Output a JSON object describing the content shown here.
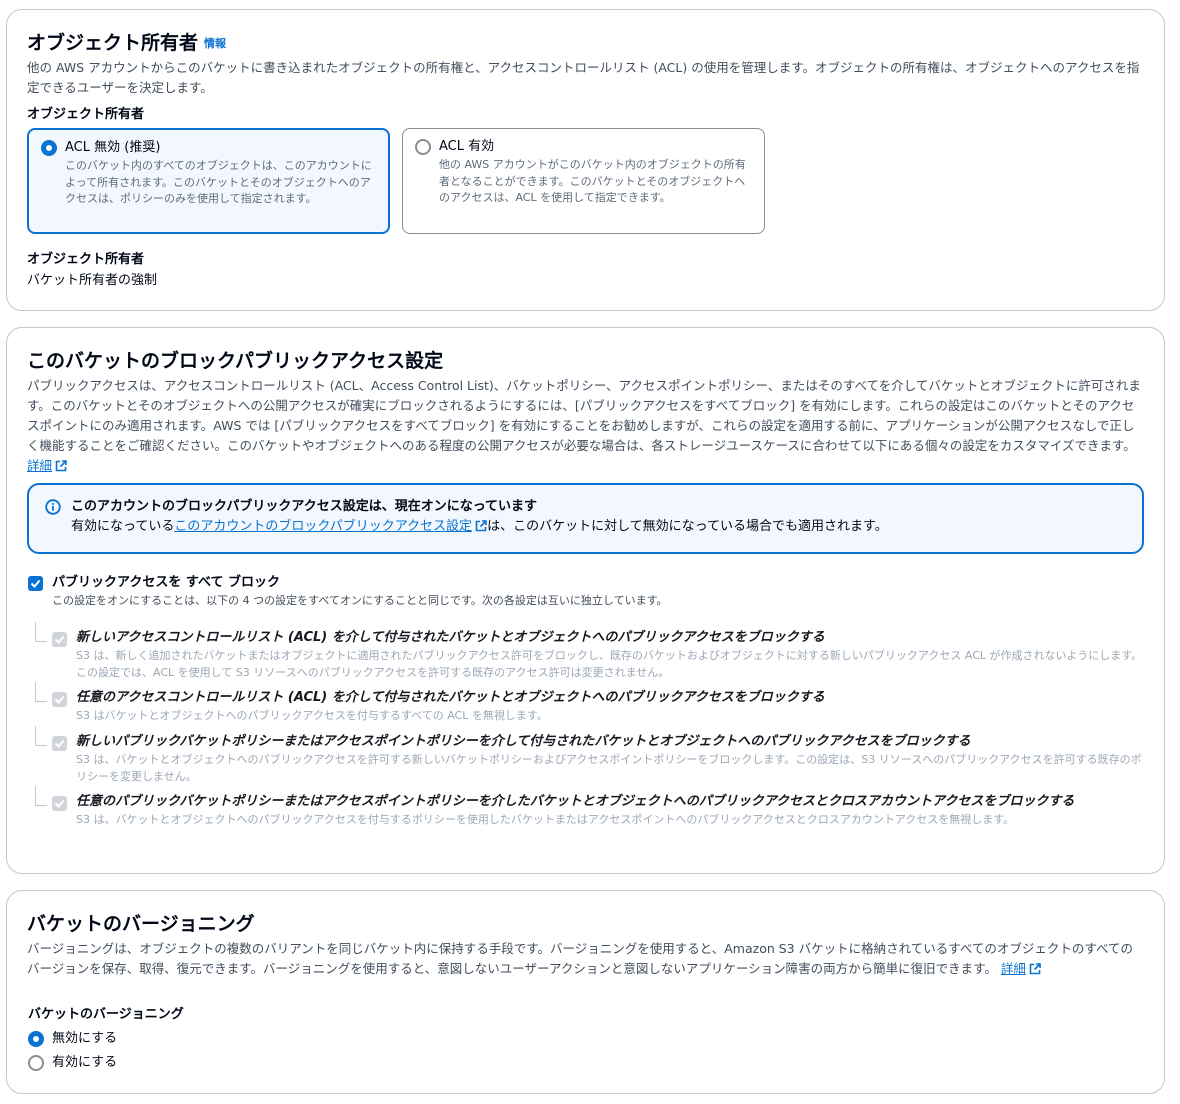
{
  "object_ownership": {
    "title": "オブジェクト所有者",
    "info_link": "情報",
    "description": "他の AWS アカウントからこのバケットに書き込まれたオブジェクトの所有権と、アクセスコントロールリスト (ACL) の使用を管理します。オブジェクトの所有権は、オブジェクトへのアクセスを指定できるユーザーを決定します。",
    "field_label": "オブジェクト所有者",
    "options": [
      {
        "label": "ACL 無効 (推奨)",
        "description": "このバケット内のすべてのオブジェクトは、このアカウントによって所有されます。このバケットとそのオブジェクトへのアクセスは、ポリシーのみを使用して指定されます。",
        "selected": true
      },
      {
        "label": "ACL 有効",
        "description": "他の AWS アカウントがこのバケット内のオブジェクトの所有者となることができます。このバケットとそのオブジェクトへのアクセスは、ACL を使用して指定できます。",
        "selected": false
      }
    ],
    "summary_label": "オブジェクト所有者",
    "summary_value": "バケット所有者の強制"
  },
  "block_public_access": {
    "title": "このバケットのブロックパブリックアクセス設定",
    "description": "パブリックアクセスは、アクセスコントロールリスト (ACL、Access Control List)、バケットポリシー、アクセスポイントポリシー、またはそのすべてを介してバケットとオブジェクトに許可されます。このバケットとそのオブジェクトへの公開アクセスが確実にブロックされるようにするには、[パブリックアクセスをすべてブロック] を有効にします。これらの設定はこのバケットとそのアクセスポイントにのみ適用されます。AWS では [パブリックアクセスをすべてブロック] を有効にすることをお勧めしますが、これらの設定を適用する前に、アプリケーションが公開アクセスなしで正しく機能することをご確認ください。このバケットやオブジェクトへのある程度の公開アクセスが必要な場合は、各ストレージユースケースに合わせて以下にある個々の設定をカスタマイズできます。",
    "learn_more": "詳細",
    "alert": {
      "title": "このアカウントのブロックパブリックアクセス設定は、現在オンになっています",
      "body_prefix": "有効になっている",
      "body_link": "このアカウントのブロックパブリックアクセス設定",
      "body_suffix": "は、このバケットに対して無効になっている場合でも適用されます。"
    },
    "block_all": {
      "label": "パブリックアクセスを すべて ブロック",
      "description": "この設定をオンにすることは、以下の 4 つの設定をすべてオンにすることと同じです。次の各設定は互いに独立しています。",
      "checked": true
    },
    "settings": [
      {
        "label": "新しいアクセスコントロールリスト (ACL) を介して付与されたバケットとオブジェクトへのパブリックアクセスをブロックする",
        "description": "S3 は、新しく追加されたバケットまたはオブジェクトに適用されたパブリックアクセス許可をブロックし、既存のバケットおよびオブジェクトに対する新しいパブリックアクセス ACL が作成されないようにします。この設定では、ACL を使用して S3 リソースへのパブリックアクセスを許可する既存のアクセス許可は変更されません。",
        "checked": true
      },
      {
        "label": "任意のアクセスコントロールリスト (ACL) を介して付与されたバケットとオブジェクトへのパブリックアクセスをブロックする",
        "description": "S3 はバケットとオブジェクトへのパブリックアクセスを付与するすべての ACL を無視します。",
        "checked": true
      },
      {
        "label": "新しいパブリックバケットポリシーまたはアクセスポイントポリシーを介して付与されたバケットとオブジェクトへのパブリックアクセスをブロックする",
        "description": "S3 は、バケットとオブジェクトへのパブリックアクセスを許可する新しいバケットポリシーおよびアクセスポイントポリシーをブロックします。この設定は、S3 リソースへのパブリックアクセスを許可する既存のポリシーを変更しません。",
        "checked": true
      },
      {
        "label": "任意のパブリックバケットポリシーまたはアクセスポイントポリシーを介したバケットとオブジェクトへのパブリックアクセスとクロスアカウントアクセスをブロックする",
        "description": "S3 は、バケットとオブジェクトへのパブリックアクセスを付与するポリシーを使用したバケットまたはアクセスポイントへのパブリックアクセスとクロスアカウントアクセスを無視します。",
        "checked": true
      }
    ]
  },
  "versioning": {
    "title": "バケットのバージョニング",
    "description": "バージョニングは、オブジェクトの複数のバリアントを同じバケット内に保持する手段です。バージョニングを使用すると、Amazon S3 バケットに格納されているすべてのオブジェクトのすべてのバージョンを保存、取得、復元できます。バージョニングを使用すると、意図しないユーザーアクションと意図しないアプリケーション障害の両方から簡単に復旧できます。",
    "learn_more": "詳細",
    "field_label": "バケットのバージョニング",
    "options": [
      {
        "label": "無効にする",
        "selected": true
      },
      {
        "label": "有効にする",
        "selected": false
      }
    ]
  },
  "colors": {
    "accent": "#0972d3",
    "border": "#c6c6cd",
    "disabled_check": "#d1d5db"
  },
  "icons": {
    "info": "info-circle-icon",
    "external": "external-link-icon",
    "check": "check-icon"
  }
}
